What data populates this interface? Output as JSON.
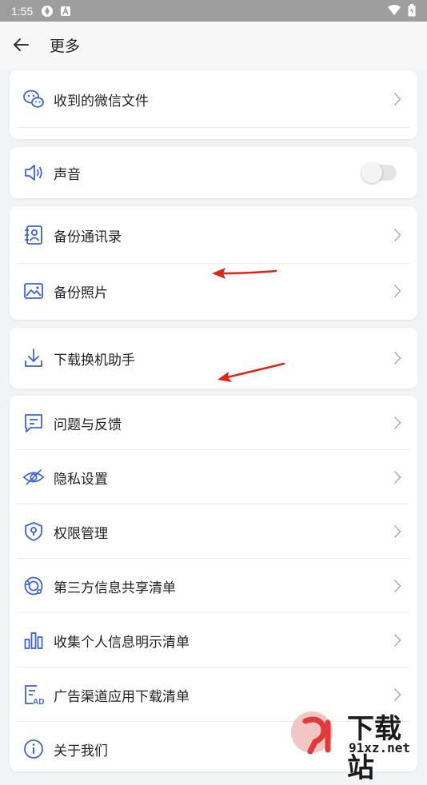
{
  "status_bar": {
    "time": "1:55"
  },
  "header": {
    "title": "更多"
  },
  "groups": [
    {
      "items": [
        {
          "label": "收到的微信文件",
          "icon": "wechat-icon"
        }
      ]
    },
    {
      "items": [
        {
          "label": "声音",
          "icon": "speaker-icon",
          "toggle": false
        }
      ]
    },
    {
      "items": [
        {
          "label": "备份通讯录",
          "icon": "contacts-icon"
        },
        {
          "label": "备份照片",
          "icon": "photo-icon"
        }
      ]
    },
    {
      "items": [
        {
          "label": "下载换机助手",
          "icon": "download-icon"
        }
      ]
    },
    {
      "items": [
        {
          "label": "问题与反馈",
          "icon": "feedback-icon"
        },
        {
          "label": "隐私设置",
          "icon": "privacy-eye-icon"
        },
        {
          "label": "权限管理",
          "icon": "shield-icon"
        },
        {
          "label": "第三方信息共享清单",
          "icon": "share-list-icon"
        },
        {
          "label": "收集个人信息明示清单",
          "icon": "bar-chart-icon"
        },
        {
          "label": "广告渠道应用下载清单",
          "icon": "ad-list-icon"
        },
        {
          "label": "关于我们",
          "icon": "info-icon"
        }
      ]
    }
  ],
  "watermark": {
    "brand": "下载站",
    "site": "91xz.net"
  },
  "colors": {
    "accent": "#3d63d8",
    "annotation_arrow": "#e0261c"
  }
}
